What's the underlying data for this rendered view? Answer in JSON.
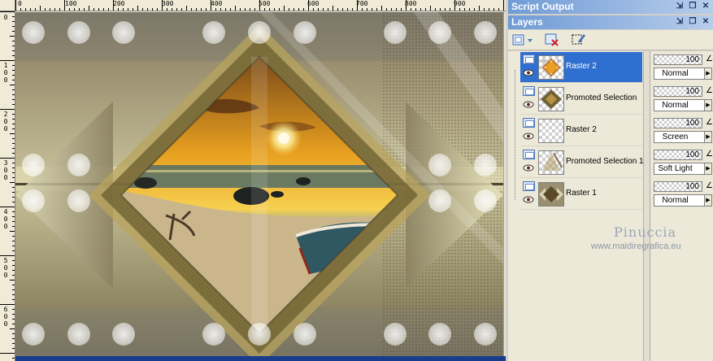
{
  "app": {
    "panels": {
      "script_output": {
        "title": "Script Output"
      },
      "layers": {
        "title": "Layers"
      }
    }
  },
  "rulers": {
    "horizontal": [
      "0",
      "100",
      "200",
      "300",
      "400",
      "500",
      "600",
      "700",
      "800",
      "900"
    ],
    "vertical": [
      [
        "0"
      ],
      [
        "1",
        "0",
        "0"
      ],
      [
        "2",
        "0",
        "0"
      ],
      [
        "3",
        "0",
        "0"
      ],
      [
        "4",
        "0",
        "0"
      ],
      [
        "5",
        "0",
        "0"
      ],
      [
        "6",
        "0",
        "0"
      ]
    ]
  },
  "toolbar": {
    "icons": [
      "new-raster-layer-icon",
      "delete-layer-icon",
      "edit-selection-icon"
    ]
  },
  "layers": [
    {
      "name": "Raster 2",
      "opacity": "100",
      "blend": "Normal",
      "selected": true,
      "thumb": "pattern"
    },
    {
      "name": "Promoted Selection",
      "opacity": "100",
      "blend": "Normal",
      "selected": false,
      "thumb": "diamond"
    },
    {
      "name": "Raster 2",
      "opacity": "100",
      "blend": "Screen",
      "selected": false,
      "thumb": "empty"
    },
    {
      "name": "Promoted Selection 1",
      "opacity": "100",
      "blend": "Soft Light",
      "selected": false,
      "thumb": "light"
    },
    {
      "name": "Raster 1",
      "opacity": "100",
      "blend": "Normal",
      "selected": false,
      "thumb": "bg"
    }
  ],
  "watermark": {
    "name": "Pinuccia",
    "url": "www.maidiregrafica.eu"
  },
  "colors": {
    "title_bar": "#6f9bd6",
    "selection": "#2f6fd0",
    "panel_bg": "#ece9d8"
  }
}
